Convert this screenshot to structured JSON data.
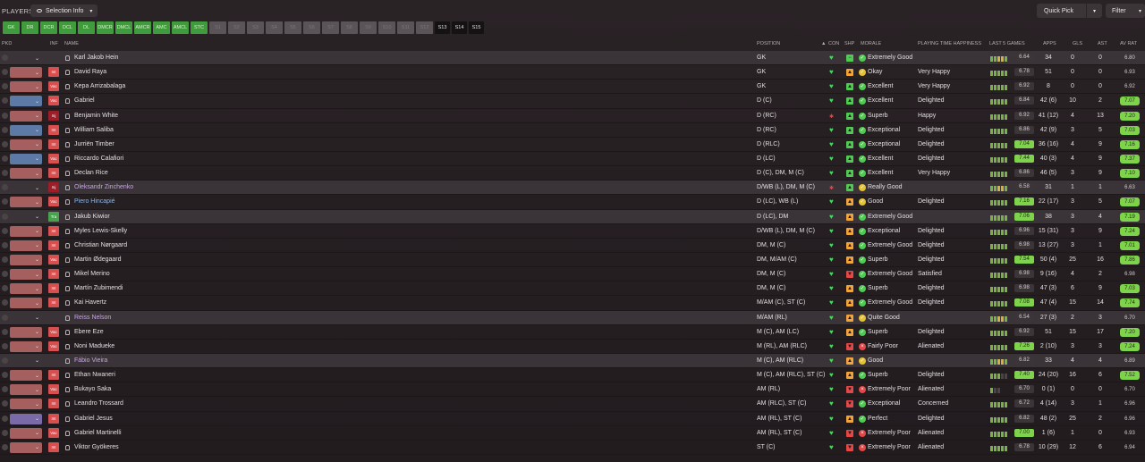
{
  "header": {
    "title": "PLAYERS",
    "selection_info": "Selection Info",
    "quick_pick": "Quick Pick",
    "filter": "Filter"
  },
  "chips": [
    {
      "label": "GK",
      "state": "on"
    },
    {
      "label": "DR",
      "state": "on"
    },
    {
      "label": "DCR",
      "state": "on"
    },
    {
      "label": "DCL",
      "state": "on"
    },
    {
      "label": "DL",
      "state": "on"
    },
    {
      "label": "DMCR",
      "state": "on"
    },
    {
      "label": "DMCL",
      "state": "on"
    },
    {
      "label": "AMCR",
      "state": "on"
    },
    {
      "label": "AMC",
      "state": "on"
    },
    {
      "label": "AMCL",
      "state": "on"
    },
    {
      "label": "STC",
      "state": "on"
    },
    {
      "label": "S1",
      "state": "off"
    },
    {
      "label": "S2",
      "state": "off"
    },
    {
      "label": "S3",
      "state": "off"
    },
    {
      "label": "S4",
      "state": "off"
    },
    {
      "label": "S5",
      "state": "off"
    },
    {
      "label": "S6",
      "state": "off"
    },
    {
      "label": "S7",
      "state": "off"
    },
    {
      "label": "S8",
      "state": "off"
    },
    {
      "label": "S9",
      "state": "off"
    },
    {
      "label": "S10",
      "state": "off"
    },
    {
      "label": "S11",
      "state": "off"
    },
    {
      "label": "S12",
      "state": "off"
    },
    {
      "label": "S13",
      "state": "dark"
    },
    {
      "label": "S14",
      "state": "dark"
    },
    {
      "label": "S15",
      "state": "dark"
    }
  ],
  "columns": {
    "pkd": "PKD",
    "inf": "INF",
    "name": "NAME",
    "position": "POSITION",
    "con": "CON",
    "shp": "SHP",
    "morale": "MORALE",
    "playing_time": "PLAYING TIME HAPPINESS",
    "last5": "LAST 5 GAMES",
    "apps": "APPS",
    "gls": "GLS",
    "ast": "AST",
    "av_rat": "AV RAT"
  },
  "players": [
    {
      "name": "Karl Jakob Hein",
      "pos": "GK",
      "con": "g",
      "shp": "g",
      "shp_icon": "−",
      "mor": "g",
      "morale": "Extremely Good",
      "happy": "",
      "bars": "ggyyg",
      "l5": "6.64",
      "l5hi": false,
      "apps": "34",
      "gls": "0",
      "ast": "0",
      "av": "6.80",
      "avhi": false,
      "inf": "",
      "infc": "",
      "dd": "blank",
      "hl": true,
      "nc": ""
    },
    {
      "name": "David Raya",
      "pos": "GK",
      "con": "g",
      "shp": "o",
      "shp_icon": "▲",
      "mor": "y",
      "morale": "Okay",
      "happy": "Very Happy",
      "bars": "ggggg",
      "l5": "6.78",
      "l5hi": false,
      "apps": "51",
      "gls": "0",
      "ast": "0",
      "av": "6.93",
      "avhi": false,
      "inf": "Int",
      "infc": "int",
      "dd": "red",
      "hl": false,
      "nc": ""
    },
    {
      "name": "Kepa Arrizabalaga",
      "pos": "GK",
      "con": "g",
      "shp": "g",
      "shp_icon": "▲",
      "mor": "g",
      "morale": "Excellent",
      "happy": "Very Happy",
      "bars": "ggggg",
      "l5": "6.92",
      "l5hi": false,
      "apps": "8",
      "gls": "0",
      "ast": "0",
      "av": "6.92",
      "avhi": false,
      "inf": "Vac",
      "infc": "vac",
      "dd": "red",
      "hl": false,
      "nc": ""
    },
    {
      "name": "Gabriel",
      "pos": "D (C)",
      "con": "g",
      "shp": "g",
      "shp_icon": "▲",
      "mor": "g",
      "morale": "Excellent",
      "happy": "Delighted",
      "bars": "ggggg",
      "l5": "6.84",
      "l5hi": false,
      "apps": "42 (6)",
      "gls": "10",
      "ast": "2",
      "av": "7.07",
      "avhi": true,
      "inf": "Vac",
      "infc": "vac",
      "dd": "blue",
      "hl": false,
      "nc": ""
    },
    {
      "name": "Benjamin White",
      "pos": "D (RC)",
      "con": "r",
      "shp": "g",
      "shp_icon": "▲",
      "mor": "g",
      "morale": "Superb",
      "happy": "Happy",
      "bars": "ggggg",
      "l5": "6.92",
      "l5hi": false,
      "apps": "41 (12)",
      "gls": "4",
      "ast": "13",
      "av": "7.20",
      "avhi": true,
      "inf": "Inj",
      "infc": "inj",
      "dd": "red",
      "hl": false,
      "nc": ""
    },
    {
      "name": "William Saliba",
      "pos": "D (RC)",
      "con": "g",
      "shp": "g",
      "shp_icon": "▲",
      "mor": "g",
      "morale": "Exceptional",
      "happy": "Delighted",
      "bars": "ggggg",
      "l5": "6.86",
      "l5hi": false,
      "apps": "42 (9)",
      "gls": "3",
      "ast": "5",
      "av": "7.03",
      "avhi": true,
      "inf": "Int",
      "infc": "int",
      "dd": "blue",
      "hl": false,
      "nc": ""
    },
    {
      "name": "Jurriën Timber",
      "pos": "D (RLC)",
      "con": "g",
      "shp": "g",
      "shp_icon": "▲",
      "mor": "g",
      "morale": "Exceptional",
      "happy": "Delighted",
      "bars": "ggggg",
      "l5": "7.04",
      "l5hi": true,
      "apps": "36 (16)",
      "gls": "4",
      "ast": "9",
      "av": "7.16",
      "avhi": true,
      "inf": "Int",
      "infc": "int",
      "dd": "red",
      "hl": false,
      "nc": ""
    },
    {
      "name": "Riccardo Calafiori",
      "pos": "D (LC)",
      "con": "g",
      "shp": "g",
      "shp_icon": "▲",
      "mor": "g",
      "morale": "Excellent",
      "happy": "Delighted",
      "bars": "ggggg",
      "l5": "7.44",
      "l5hi": true,
      "apps": "40 (3)",
      "gls": "4",
      "ast": "9",
      "av": "7.37",
      "avhi": true,
      "inf": "Vac",
      "infc": "vac",
      "dd": "blue",
      "hl": false,
      "nc": ""
    },
    {
      "name": "Declan Rice",
      "pos": "D (C), DM, M (C)",
      "con": "g",
      "shp": "g",
      "shp_icon": "▲",
      "mor": "g",
      "morale": "Excellent",
      "happy": "Very Happy",
      "bars": "ggggg",
      "l5": "6.86",
      "l5hi": false,
      "apps": "46 (5)",
      "gls": "3",
      "ast": "9",
      "av": "7.10",
      "avhi": true,
      "inf": "Int",
      "infc": "int",
      "dd": "red",
      "hl": false,
      "nc": ""
    },
    {
      "name": "Oleksandr Zinchenko",
      "pos": "D/WB (L), DM, M (C)",
      "con": "r",
      "shp": "g",
      "shp_icon": "▲",
      "mor": "y",
      "morale": "Really Good",
      "happy": "",
      "bars": "ggyyg",
      "l5": "6.58",
      "l5hi": false,
      "apps": "31",
      "gls": "1",
      "ast": "1",
      "av": "6.63",
      "avhi": false,
      "inf": "Inj",
      "infc": "inj",
      "dd": "blank",
      "hl": true,
      "nc": "purple"
    },
    {
      "name": "Piero Hincapié",
      "pos": "D (LC), WB (L)",
      "con": "g",
      "shp": "o",
      "shp_icon": "▲",
      "mor": "y",
      "morale": "Good",
      "happy": "Delighted",
      "bars": "ggggg",
      "l5": "7.16",
      "l5hi": true,
      "apps": "22 (17)",
      "gls": "3",
      "ast": "5",
      "av": "7.07",
      "avhi": true,
      "inf": "Vac",
      "infc": "vac",
      "dd": "red",
      "hl": false,
      "nc": "blue"
    },
    {
      "name": "Jakub Kiwior",
      "pos": "D (LC), DM",
      "con": "g",
      "shp": "o",
      "shp_icon": "▲",
      "mor": "g",
      "morale": "Extremely Good",
      "happy": "",
      "bars": "ggggg",
      "l5": "7.06",
      "l5hi": true,
      "apps": "38",
      "gls": "3",
      "ast": "4",
      "av": "7.19",
      "avhi": true,
      "inf": "Tra",
      "infc": "tra",
      "dd": "blank",
      "hl": true,
      "nc": ""
    },
    {
      "name": "Myles Lewis-Skelly",
      "pos": "D/WB (L), DM, M (C)",
      "con": "g",
      "shp": "o",
      "shp_icon": "▲",
      "mor": "g",
      "morale": "Exceptional",
      "happy": "Delighted",
      "bars": "ggggg",
      "l5": "6.96",
      "l5hi": false,
      "apps": "15 (31)",
      "gls": "3",
      "ast": "9",
      "av": "7.24",
      "avhi": true,
      "inf": "Int",
      "infc": "int",
      "dd": "red",
      "hl": false,
      "nc": ""
    },
    {
      "name": "Christian Nørgaard",
      "pos": "DM, M (C)",
      "con": "g",
      "shp": "o",
      "shp_icon": "▲",
      "mor": "g",
      "morale": "Extremely Good",
      "happy": "Delighted",
      "bars": "ggggg",
      "l5": "6.98",
      "l5hi": false,
      "apps": "13 (27)",
      "gls": "3",
      "ast": "1",
      "av": "7.01",
      "avhi": true,
      "inf": "Int",
      "infc": "int",
      "dd": "red",
      "hl": false,
      "nc": ""
    },
    {
      "name": "Martin Ødegaard",
      "pos": "DM, M/AM (C)",
      "con": "g",
      "shp": "o",
      "shp_icon": "▲",
      "mor": "g",
      "morale": "Superb",
      "happy": "Delighted",
      "bars": "ggggg",
      "l5": "7.54",
      "l5hi": true,
      "apps": "50 (4)",
      "gls": "25",
      "ast": "16",
      "av": "7.86",
      "avhi": true,
      "inf": "Vac",
      "infc": "vac",
      "dd": "red",
      "hl": false,
      "nc": ""
    },
    {
      "name": "Mikel Merino",
      "pos": "DM, M (C)",
      "con": "g",
      "shp": "r",
      "shp_icon": "▼",
      "mor": "g",
      "morale": "Extremely Good",
      "happy": "Satisfied",
      "bars": "ggggg",
      "l5": "6.98",
      "l5hi": false,
      "apps": "9 (16)",
      "gls": "4",
      "ast": "2",
      "av": "6.98",
      "avhi": false,
      "inf": "Int",
      "infc": "int",
      "dd": "red",
      "hl": false,
      "nc": ""
    },
    {
      "name": "Martín Zubimendi",
      "pos": "DM, M (C)",
      "con": "g",
      "shp": "o",
      "shp_icon": "▲",
      "mor": "g",
      "morale": "Superb",
      "happy": "Delighted",
      "bars": "ggggg",
      "l5": "6.98",
      "l5hi": false,
      "apps": "47 (3)",
      "gls": "6",
      "ast": "9",
      "av": "7.03",
      "avhi": true,
      "inf": "Int",
      "infc": "int",
      "dd": "red",
      "hl": false,
      "nc": ""
    },
    {
      "name": "Kai Havertz",
      "pos": "M/AM (C), ST (C)",
      "con": "g",
      "shp": "o",
      "shp_icon": "▲",
      "mor": "g",
      "morale": "Extremely Good",
      "happy": "Delighted",
      "bars": "ggggg",
      "l5": "7.08",
      "l5hi": true,
      "apps": "47 (4)",
      "gls": "15",
      "ast": "14",
      "av": "7.74",
      "avhi": true,
      "inf": "Int",
      "infc": "int",
      "dd": "red",
      "hl": false,
      "nc": ""
    },
    {
      "name": "Reiss Nelson",
      "pos": "M/AM (RL)",
      "con": "g",
      "shp": "o",
      "shp_icon": "▲",
      "mor": "y",
      "morale": "Quite Good",
      "happy": "",
      "bars": "ggyyg",
      "l5": "6.54",
      "l5hi": false,
      "apps": "27 (3)",
      "gls": "2",
      "ast": "3",
      "av": "6.70",
      "avhi": false,
      "inf": "",
      "infc": "",
      "dd": "blank",
      "hl": true,
      "nc": "purple"
    },
    {
      "name": "Ebere Eze",
      "pos": "M (C), AM (LC)",
      "con": "g",
      "shp": "o",
      "shp_icon": "▲",
      "mor": "g",
      "morale": "Superb",
      "happy": "Delighted",
      "bars": "ggggg",
      "l5": "6.92",
      "l5hi": false,
      "apps": "51",
      "gls": "15",
      "ast": "17",
      "av": "7.20",
      "avhi": true,
      "inf": "Vac",
      "infc": "vac",
      "dd": "red",
      "hl": false,
      "nc": ""
    },
    {
      "name": "Noni Madueke",
      "pos": "M (RL), AM (RLC)",
      "con": "g",
      "shp": "r",
      "shp_icon": "▼",
      "mor": "r",
      "morale": "Fairly Poor",
      "happy": "Alienated",
      "bars": "ggggg",
      "l5": "7.26",
      "l5hi": true,
      "apps": "2 (10)",
      "gls": "3",
      "ast": "3",
      "av": "7.24",
      "avhi": true,
      "inf": "Vac",
      "infc": "vac",
      "dd": "red",
      "hl": false,
      "nc": ""
    },
    {
      "name": "Fábio Vieira",
      "pos": "M (C), AM (RLC)",
      "con": "g",
      "shp": "o",
      "shp_icon": "▲",
      "mor": "y",
      "morale": "Good",
      "happy": "",
      "bars": "ggyyg",
      "l5": "6.82",
      "l5hi": false,
      "apps": "33",
      "gls": "4",
      "ast": "4",
      "av": "6.89",
      "avhi": false,
      "inf": "",
      "infc": "",
      "dd": "blank",
      "hl": true,
      "nc": "purple"
    },
    {
      "name": "Ethan Nwaneri",
      "pos": "M (C), AM (RLC), ST (C)",
      "con": "g",
      "shp": "o",
      "shp_icon": "▲",
      "mor": "g",
      "morale": "Superb",
      "happy": "Delighted",
      "bars": "gggee",
      "l5": "7.40",
      "l5hi": true,
      "apps": "24 (20)",
      "gls": "16",
      "ast": "6",
      "av": "7.52",
      "avhi": true,
      "inf": "Int",
      "infc": "int",
      "dd": "red",
      "hl": false,
      "nc": ""
    },
    {
      "name": "Bukayo Saka",
      "pos": "AM (RL)",
      "con": "g",
      "shp": "r",
      "shp_icon": "▼",
      "mor": "r",
      "morale": "Extremely Poor",
      "happy": "Alienated",
      "bars": "gee",
      "l5": "6.70",
      "l5hi": false,
      "apps": "0 (1)",
      "gls": "0",
      "ast": "0",
      "av": "6.70",
      "avhi": false,
      "inf": "Vac",
      "infc": "vac",
      "dd": "red",
      "hl": false,
      "nc": ""
    },
    {
      "name": "Leandro Trossard",
      "pos": "AM (RLC), ST (C)",
      "con": "g",
      "shp": "r",
      "shp_icon": "▼",
      "mor": "g",
      "morale": "Exceptional",
      "happy": "Concerned",
      "bars": "ggggg",
      "l5": "6.72",
      "l5hi": false,
      "apps": "4 (14)",
      "gls": "3",
      "ast": "1",
      "av": "6.96",
      "avhi": false,
      "inf": "Int",
      "infc": "int",
      "dd": "red",
      "hl": false,
      "nc": ""
    },
    {
      "name": "Gabriel Jesus",
      "pos": "AM (RL), ST (C)",
      "con": "g",
      "shp": "o",
      "shp_icon": "▲",
      "mor": "g",
      "morale": "Perfect",
      "happy": "Delighted",
      "bars": "ggggg",
      "l5": "6.82",
      "l5hi": false,
      "apps": "48 (2)",
      "gls": "25",
      "ast": "2",
      "av": "6.96",
      "avhi": false,
      "inf": "Int",
      "infc": "int",
      "dd": "purple",
      "hl": false,
      "nc": ""
    },
    {
      "name": "Gabriel Martinelli",
      "pos": "AM (RL), ST (C)",
      "con": "g",
      "shp": "r",
      "shp_icon": "▼",
      "mor": "r",
      "morale": "Extremely Poor",
      "happy": "Alienated",
      "bars": "ggggg",
      "l5": "7.00",
      "l5hi": true,
      "apps": "1 (6)",
      "gls": "1",
      "ast": "0",
      "av": "6.93",
      "avhi": false,
      "inf": "Vac",
      "infc": "vac",
      "dd": "red",
      "hl": false,
      "nc": ""
    },
    {
      "name": "Viktor Gyökeres",
      "pos": "ST (C)",
      "con": "g",
      "shp": "r",
      "shp_icon": "▼",
      "mor": "r",
      "morale": "Extremely Poor",
      "happy": "Alienated",
      "bars": "ggggg",
      "l5": "6.78",
      "l5hi": false,
      "apps": "10 (29)",
      "gls": "12",
      "ast": "6",
      "av": "6.94",
      "avhi": false,
      "inf": "Int",
      "infc": "int",
      "dd": "red",
      "hl": false,
      "nc": ""
    }
  ]
}
